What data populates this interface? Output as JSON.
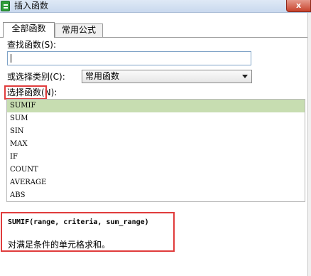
{
  "window": {
    "title": "插入函数",
    "close_label": "x"
  },
  "tabs": [
    {
      "label": "全部函数",
      "active": true
    },
    {
      "label": "常用公式",
      "active": false
    }
  ],
  "search": {
    "label": "查找函数(S):",
    "value": ""
  },
  "category": {
    "label": "或选择类别(C):",
    "selected": "常用函数"
  },
  "function_list": {
    "label": "选择函数(N):",
    "items": [
      "SUMIF",
      "SUM",
      "SIN",
      "MAX",
      "IF",
      "COUNT",
      "AVERAGE",
      "ABS"
    ],
    "selected": "SUMIF"
  },
  "description": {
    "signature": "SUMIF(range, criteria, sum_range)",
    "text": "对满足条件的单元格求和。"
  },
  "colors": {
    "selection": "#c7ddb1",
    "highlight_box": "#e03c3c",
    "title_bar": "#c9d9ee"
  }
}
